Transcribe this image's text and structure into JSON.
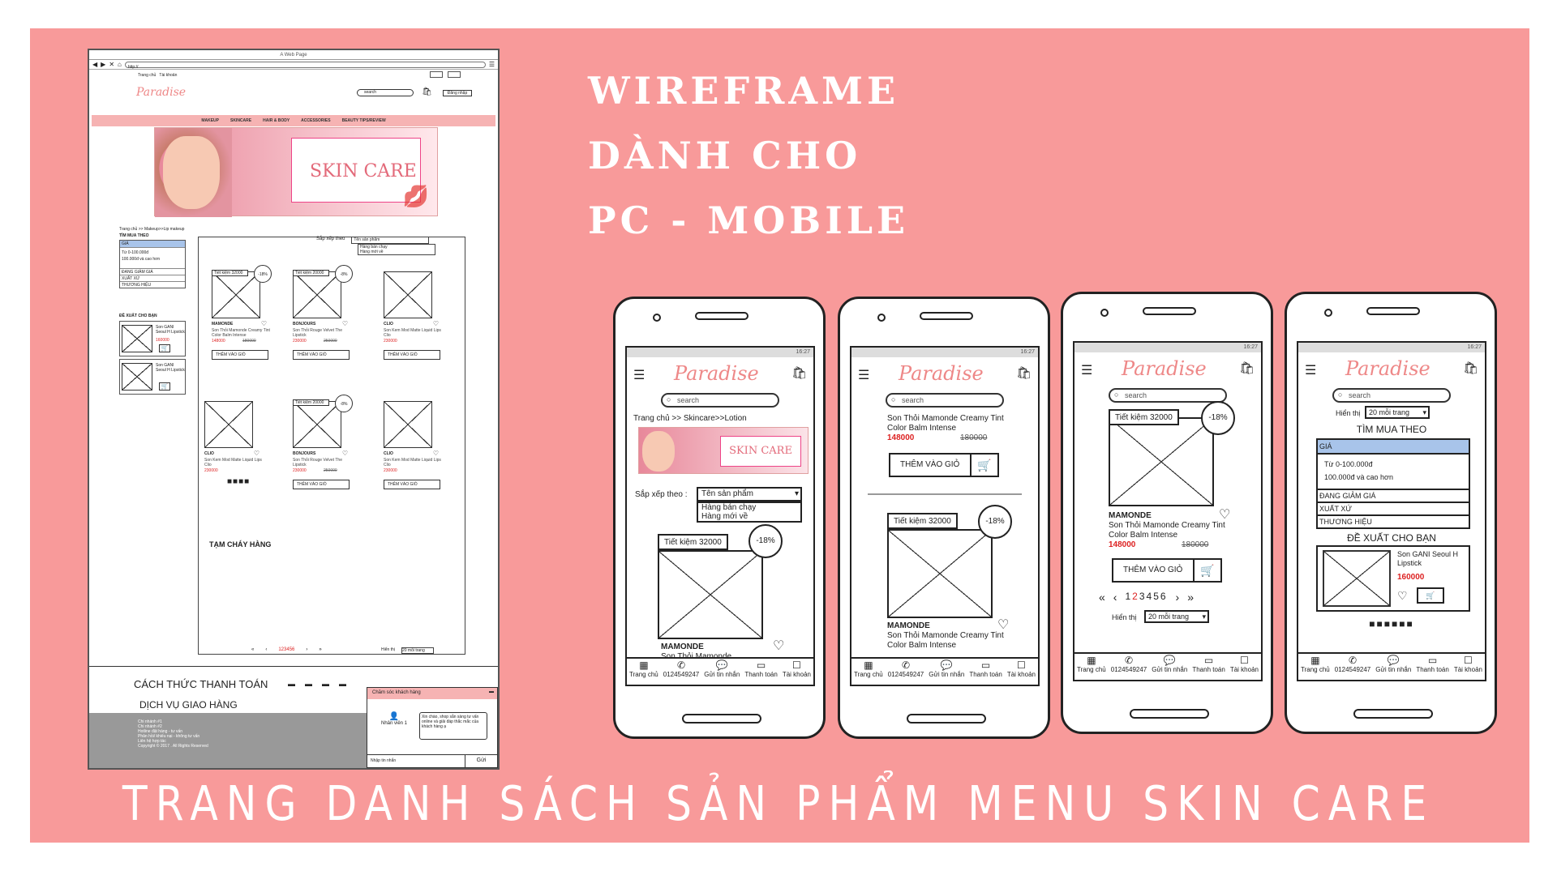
{
  "colors": {
    "board": "#f89a9a",
    "accent_pink": "#f6b3b3",
    "price_red": "#d22222",
    "selected_blue": "#a8c4ea"
  },
  "heading": {
    "line1": "WIREFRAME",
    "line2": "DÀNH CHO",
    "line3": "PC - MOBILE",
    "bottom": "TRANG DANH SÁCH SẢN PHẨM MENU SKIN CARE"
  },
  "pc": {
    "window_title": "A Web Page",
    "address": "http://",
    "topnav": [
      "Trang chủ",
      "Tài khoản"
    ],
    "logo": "Paradise",
    "search_placeholder": "search",
    "login_button": "Đăng nhập",
    "menu": [
      "MAKEUP",
      "SKINCARE",
      "HAIR & BODY",
      "ACCESSORIES",
      "BEAUTY TIPS/REVIEW"
    ],
    "banner_text": "SKIN CARE",
    "breadcrumb": "Trang chủ >> Makeup>>Lip makeup",
    "filter": {
      "title": "TÌM MUA THEO",
      "price_label": "GIÁ",
      "range1": "Từ 0-100.000đ",
      "range2": "100.000đ và cao hơn",
      "rows": [
        "ĐANG GIẢM GIÁ",
        "XUẤT XỨ",
        "THƯƠNG HIỆU"
      ]
    },
    "recommend": {
      "title": "ĐỀ XUẤT CHO BẠN",
      "items": [
        {
          "name": "Son GANI Seoul H Lipstick",
          "price": "160000"
        },
        {
          "name": "Son GANI Seoul H Lipstick",
          "price": ""
        }
      ],
      "more": "■■■■"
    },
    "sort": {
      "label": "Sắp xếp theo",
      "selected": "Tên sản phẩm",
      "options": [
        "Hàng bán chạy",
        "Hàng mới về"
      ]
    },
    "products": [
      {
        "save": "Tiết kiệm 32000",
        "badge": "-18%",
        "name": "MAMONDE",
        "desc": "Son Thỏi Mamonde Creamy Tint Color Balm Intense",
        "price": "148000",
        "old": "180000",
        "btn": "THÊM VÀO GIỎ"
      },
      {
        "save": "Tiết kiệm 20000",
        "badge": "-8%",
        "name": "BONJOURS",
        "desc": "Son Thỏi Rouge Velvet The Lipstick",
        "price": "230000",
        "old": "250000",
        "btn": "THÊM VÀO GIỎ"
      },
      {
        "save": "",
        "badge": "",
        "name": "CLIO",
        "desc": "Son Kem Mod Matte Liquid Lips Clio",
        "price": "230000",
        "old": "",
        "btn": "THÊM VÀO GIỎ"
      },
      {
        "save": "",
        "badge": "",
        "name": "CLIO",
        "desc": "Son Kem Mod Matte Liquid Lips Clio",
        "price": "230000",
        "old": "",
        "btn": ""
      },
      {
        "save": "Tiết kiệm 20000",
        "badge": "-8%",
        "name": "BONJOURS",
        "desc": "Son Thỏi Rouge Velvet The Lipstick",
        "price": "230000",
        "old": "250000",
        "btn": "THÊM VÀO GIỎ"
      },
      {
        "save": "",
        "badge": "",
        "name": "CLIO",
        "desc": "Son Kem Mod Matte Liquid Lips Clio",
        "price": "230000",
        "old": "",
        "btn": "THÊM VÀO GIỎ"
      }
    ],
    "sold_out": "TẠM CHÁY HÀNG",
    "pager": {
      "prev2": "«",
      "prev": "‹",
      "pages": "123456",
      "next": "›",
      "next2": "»"
    },
    "per_page": {
      "label": "Hiển thị",
      "value": "20 mỗi trang"
    },
    "payment_title": "CÁCH THỨC THANH TOÁN",
    "delivery_title": "DỊCH VỤ GIAO HÀNG",
    "footer": [
      "Chi nhánh #1",
      "Chi nhánh #2",
      "Hotline đặt hàng - tư vấn",
      "Phản hồi/ khiếu nại - không tư vấn",
      "Liên hệ hợp tác",
      "Copyright © 2017 . All Rights Reserved"
    ],
    "chat": {
      "title": "Chăm sóc khách hàng",
      "agent": "Nhân viên 1",
      "message": "Xin chào, shop sẵn sàng tư vấn online và giải đáp thắc mắc của khách hàng ạ",
      "input_placeholder": "Nhập tin nhắn",
      "send": "Gửi"
    }
  },
  "mobile": {
    "status_time": "16:27",
    "logo": "Paradise",
    "search_placeholder": "search",
    "tabs": [
      "Trang chủ",
      "0124549247",
      "Gửi tin nhắn",
      "Thanh toán",
      "Tài khoản"
    ],
    "phone1": {
      "breadcrumb": "Trang chủ >> Skincare>>Lotion",
      "banner_text": "SKIN CARE",
      "sort_label": "Sắp xếp theo :",
      "sort_selected": "Tên sản phẩm",
      "sort_options": [
        "Hàng bán chạy",
        "Hàng mới về"
      ],
      "save": "Tiết kiệm 32000",
      "badge": "-18%",
      "name": "MAMONDE",
      "desc": "Son Thỏi Mamonde"
    },
    "phone2": {
      "desc": "Son Thỏi Mamonde Creamy Tint Color Balm Intense",
      "price": "148000",
      "old": "180000",
      "btn": "THÊM VÀO GIỎ",
      "save": "Tiết kiệm 32000",
      "badge": "-18%",
      "name": "MAMONDE",
      "desc2": "Son Thỏi Mamonde Creamy Tint Color Balm Intense"
    },
    "phone3": {
      "save": "Tiết kiệm 32000",
      "badge": "-18%",
      "name": "MAMONDE",
      "desc": "Son Thỏi Mamonde Creamy Tint Color Balm Intense",
      "price": "148000",
      "old": "180000",
      "btn": "THÊM VÀO GIỎ",
      "pager_first": "«",
      "pager_prev": "‹",
      "page_1": "1",
      "page_2": "2",
      "pages_rest": "3456",
      "pager_next": "›",
      "pager_last": "»",
      "per_page_label": "Hiển thị",
      "per_page_value": "20 mỗi trang"
    },
    "phone4": {
      "per_page_label": "Hiển thị",
      "per_page_value": "20 mỗi trang",
      "filter_title": "TÌM MUA THEO",
      "price_label": "GIÁ",
      "range1": "Từ 0-100.000đ",
      "range2": "100.000đ và cao hơn",
      "rows": [
        "ĐANG GIẢM GIÁ",
        "XUẤT XỨ",
        "THƯƠNG HIỆU"
      ],
      "rec_title": "ĐỀ XUẤT CHO BẠN",
      "rec_name": "Son GANI Seoul H Lipstick",
      "rec_price": "160000",
      "dots": "■■■■■■"
    }
  }
}
